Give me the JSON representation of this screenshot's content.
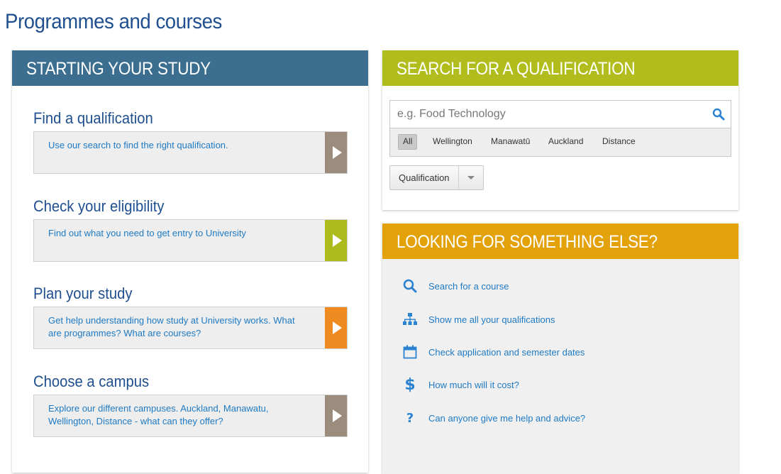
{
  "page": {
    "title": "Programmes and courses"
  },
  "starting": {
    "header": "STARTING YOUR STUDY",
    "sections": [
      {
        "title": "Find a qualification",
        "text": "Use our search to find the right qualification.",
        "arrow_color": "#9b8c7d"
      },
      {
        "title": "Check your eligibility",
        "text": "Find out what you need to get entry to University",
        "arrow_color": "#adbb1d"
      },
      {
        "title": "Plan your study",
        "text": "Get help understanding how study at University works. What are programmes? What are courses?",
        "arrow_color": "#ee8a1f"
      },
      {
        "title": "Choose a campus",
        "text": "Explore our different campuses. Auckland, Manawatu, Wellington, Distance - what can they offer?",
        "arrow_color": "#9b8c7d"
      }
    ]
  },
  "search": {
    "header": "SEARCH FOR A QUALIFICATION",
    "placeholder": "e.g. Food Technology",
    "filters": [
      "All",
      "Wellington",
      "Manawatū",
      "Auckland",
      "Distance"
    ],
    "active_filter": "All",
    "select_label": "Qualification"
  },
  "else": {
    "header": "LOOKING FOR SOMETHING ELSE?",
    "links": [
      {
        "label": "Search for a course",
        "icon": "search-icon"
      },
      {
        "label": "Show me all your qualifications",
        "icon": "hierarchy-icon"
      },
      {
        "label": "Check application and semester dates",
        "icon": "calendar-icon"
      },
      {
        "label": "How much will it cost?",
        "icon": "dollar-icon"
      },
      {
        "label": "Can anyone give me help and advice?",
        "icon": "question-icon"
      }
    ]
  },
  "colors": {
    "title_blue": "#1f4f8f",
    "link_blue": "#1f7ac4",
    "start_header": "#3b6e8f",
    "search_header": "#b1bd1c",
    "else_header": "#e3a10a"
  }
}
